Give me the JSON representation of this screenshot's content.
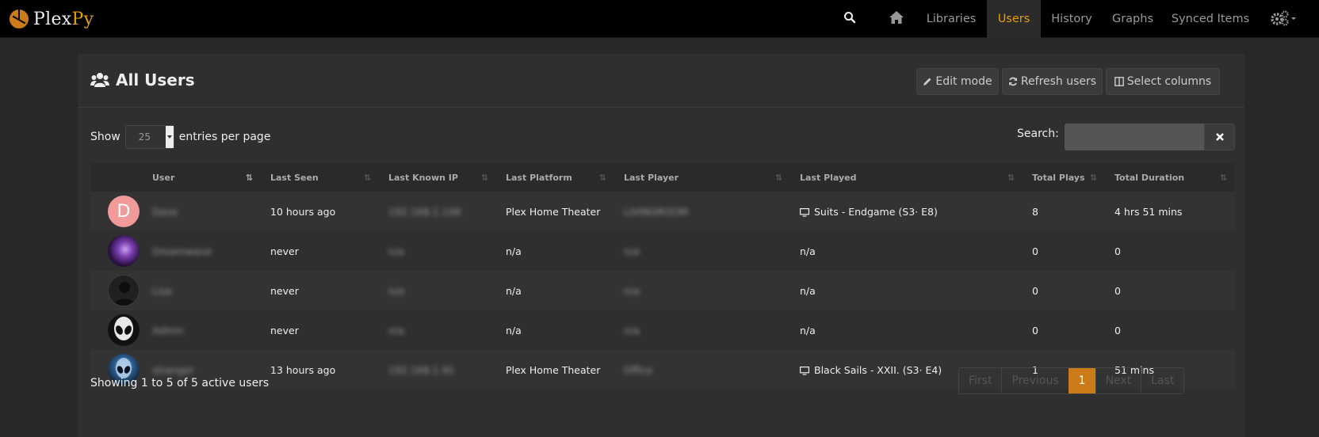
{
  "navbar": {
    "brand_main": "Plex",
    "brand_accent": "Py",
    "items": [
      {
        "label": "Libraries"
      },
      {
        "label": "Users"
      },
      {
        "label": "History"
      },
      {
        "label": "Graphs"
      },
      {
        "label": "Synced Items"
      }
    ],
    "active": "Users",
    "icons": [
      "search-icon",
      "home-icon",
      "gears-icon",
      "caret-down-icon"
    ]
  },
  "page": {
    "title": "All Users",
    "title_icon": "users-icon",
    "buttons": {
      "edit_mode": "Edit mode",
      "refresh_users": "Refresh users",
      "select_columns": "Select columns"
    }
  },
  "controls": {
    "show_label": "Show",
    "entries_value": "25",
    "entries_suffix": "entries per page",
    "search_label": "Search:",
    "search_value": ""
  },
  "table": {
    "columns": [
      "User",
      "Last Seen",
      "Last Known IP",
      "Last Platform",
      "Last Player",
      "Last Played",
      "Total Plays",
      "Total Duration"
    ],
    "rows": [
      {
        "user": "Dave",
        "last_seen": "10 hours ago",
        "ip": "192.168.1.148",
        "platform": "Plex Home Theater",
        "player": "LIVINGROOM",
        "played": "Suits - Endgame (S3· E8)",
        "total_plays": "8",
        "total_duration": "4 hrs 51 mins",
        "avatar": "letter-d"
      },
      {
        "user": "Dreamwave",
        "last_seen": "never",
        "ip": "n/a",
        "platform": "n/a",
        "player": "n/a",
        "played": "n/a",
        "total_plays": "0",
        "total_duration": "0",
        "avatar": "purple-abstract"
      },
      {
        "user": "Lisa",
        "last_seen": "never",
        "ip": "n/a",
        "platform": "n/a",
        "player": "n/a",
        "played": "n/a",
        "total_plays": "0",
        "total_duration": "0",
        "avatar": "silhouette"
      },
      {
        "user": "Admin",
        "last_seen": "never",
        "ip": "n/a",
        "platform": "n/a",
        "player": "n/a",
        "played": "n/a",
        "total_plays": "0",
        "total_duration": "0",
        "avatar": "alien"
      },
      {
        "user": "stranger",
        "last_seen": "13 hours ago",
        "ip": "192.168.1.91",
        "platform": "Plex Home Theater",
        "player": "Office",
        "played": "Black Sails - XXII. (S3· E4)",
        "total_plays": "1",
        "total_duration": "51 mins",
        "avatar": "alien-blue"
      }
    ]
  },
  "footer": {
    "info": "Showing 1 to 5 of 5 active users",
    "pager": {
      "first": "First",
      "previous": "Previous",
      "current": "1",
      "next": "Next",
      "last": "Last"
    }
  },
  "colors": {
    "accent": "#e5a00d",
    "pager_active": "#cc7b19",
    "avatar_letter_bg": "#f09a9a"
  }
}
